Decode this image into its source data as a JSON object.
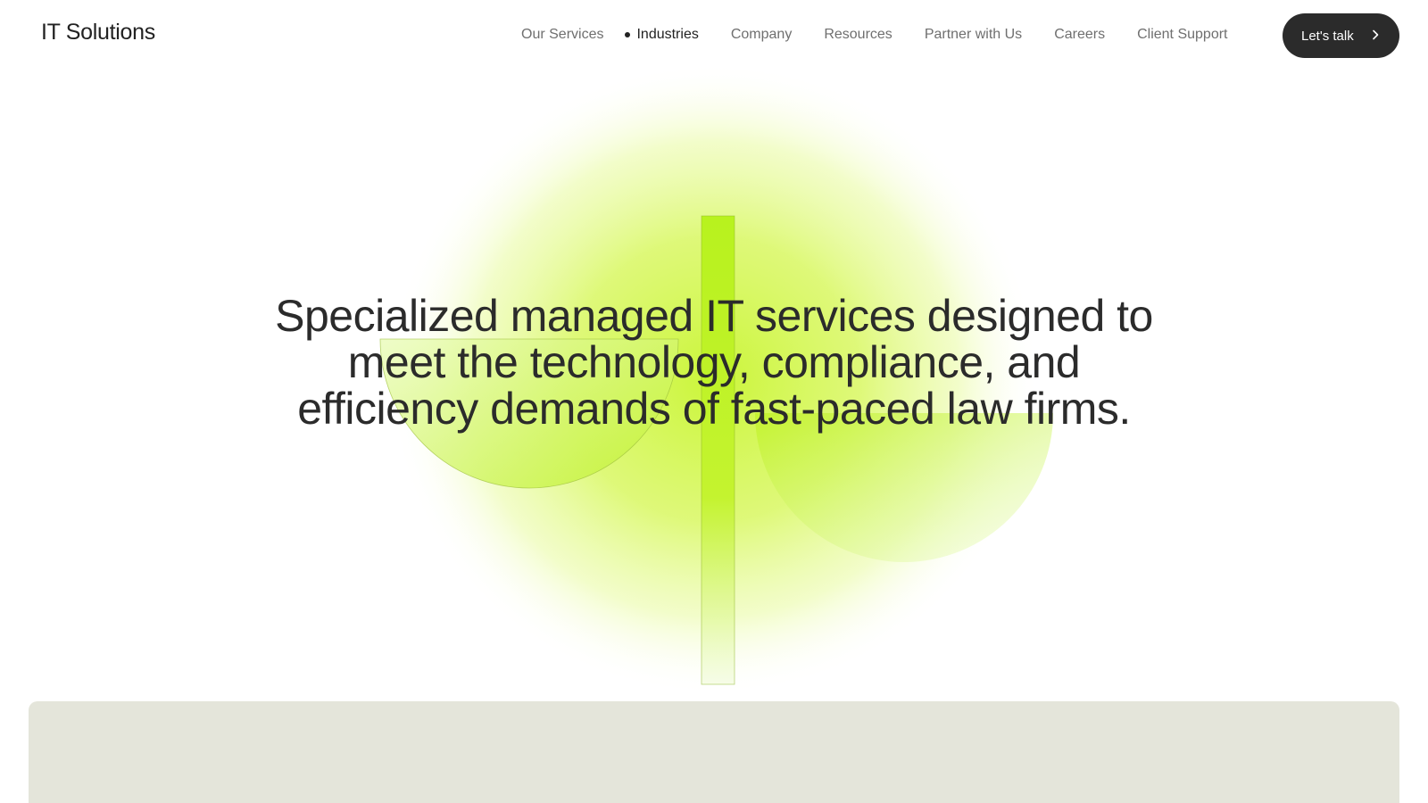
{
  "header": {
    "logo": "IT Solutions",
    "nav": [
      {
        "label": "Our Services",
        "active": false
      },
      {
        "label": "Industries",
        "active": true
      },
      {
        "label": "Company",
        "active": false
      },
      {
        "label": "Resources",
        "active": false
      },
      {
        "label": "Partner with Us",
        "active": false
      },
      {
        "label": "Careers",
        "active": false
      },
      {
        "label": "Client Support",
        "active": false
      }
    ],
    "cta_label": "Let's talk",
    "cta_icon": "chevron-right-icon"
  },
  "hero": {
    "title": "Specialized managed IT services designed to meet the technology, compliance, and efficiency demands of fast-paced law firms.",
    "illustration": "scales-of-justice"
  },
  "colors": {
    "accent": "#c6f32a",
    "text": "#2b2b2b",
    "button": "#2b2b2b",
    "panel": "#e4e5da"
  }
}
